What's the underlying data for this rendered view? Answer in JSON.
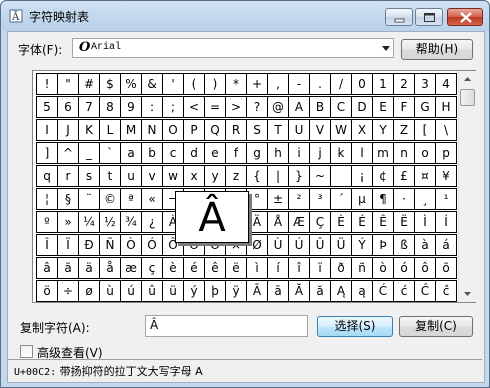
{
  "window": {
    "title": "字符映射表"
  },
  "font": {
    "label": "字体(F):",
    "selected": "Arial"
  },
  "help_button": "帮助(H)",
  "grid": {
    "rows": [
      [
        "!",
        "\"",
        "#",
        "$",
        "%",
        "&",
        "'",
        "(",
        ")",
        "*",
        "+",
        ",",
        "-",
        ".",
        "/",
        "0",
        "1",
        "2",
        "3",
        "4"
      ],
      [
        "5",
        "6",
        "7",
        "8",
        "9",
        ":",
        ";",
        "<",
        "=",
        ">",
        "?",
        "@",
        "A",
        "B",
        "C",
        "D",
        "E",
        "F",
        "G",
        "H"
      ],
      [
        "I",
        "J",
        "K",
        "L",
        "M",
        "N",
        "O",
        "P",
        "Q",
        "R",
        "S",
        "T",
        "U",
        "V",
        "W",
        "X",
        "Y",
        "Z",
        "[",
        "\\"
      ],
      [
        "]",
        "^",
        "_",
        "`",
        "a",
        "b",
        "c",
        "d",
        "e",
        "f",
        "g",
        "h",
        "i",
        "j",
        "k",
        "l",
        "m",
        "n",
        "o",
        "p"
      ],
      [
        "q",
        "r",
        "s",
        "t",
        "u",
        "v",
        "w",
        "x",
        "y",
        "z",
        "{",
        "|",
        "}",
        "~",
        "",
        "¡",
        "¢",
        "£",
        "¤",
        "¥"
      ],
      [
        "¦",
        "§",
        "¨",
        "©",
        "ª",
        "«",
        "¬",
        "",
        "®",
        "¯",
        "°",
        "±",
        "²",
        "³",
        "´",
        "µ",
        "¶",
        "·",
        "¸",
        "¹"
      ],
      [
        "º",
        "»",
        "¼",
        "½",
        "¾",
        "¿",
        "À",
        "Á",
        "Â",
        "Ã",
        "Ä",
        "Å",
        "Æ",
        "Ç",
        "È",
        "É",
        "Ê",
        "Ë",
        "Ì",
        "Í"
      ],
      [
        "Î",
        "Ï",
        "Ð",
        "Ñ",
        "Ò",
        "Ó",
        "Ô",
        "Õ",
        "Ö",
        "×",
        "Ø",
        "Ù",
        "Ú",
        "Û",
        "Ü",
        "Ý",
        "Þ",
        "ß",
        "à",
        "á"
      ],
      [
        "â",
        "ã",
        "ä",
        "å",
        "æ",
        "ç",
        "è",
        "é",
        "ê",
        "ë",
        "ì",
        "í",
        "î",
        "ï",
        "ð",
        "ñ",
        "ò",
        "ó",
        "ô",
        "õ"
      ],
      [
        "ö",
        "÷",
        "ø",
        "ù",
        "ú",
        "û",
        "ü",
        "ý",
        "þ",
        "ÿ",
        "Ā",
        "ā",
        "Ă",
        "ă",
        "Ą",
        "ą",
        "Ć",
        "ć",
        "Ĉ",
        "ĉ"
      ]
    ],
    "selected": {
      "row": 6,
      "col": 8
    },
    "magnified_char": "Â"
  },
  "copy": {
    "label": "复制字符(A):",
    "value": "Â",
    "select_button": "选择(S)",
    "copy_button": "复制(C)"
  },
  "advanced": {
    "label": "高级查看(V)",
    "checked": false
  },
  "status": {
    "code": "U+00C2:",
    "description": "带扬抑符的拉丁文大写字母 A"
  }
}
